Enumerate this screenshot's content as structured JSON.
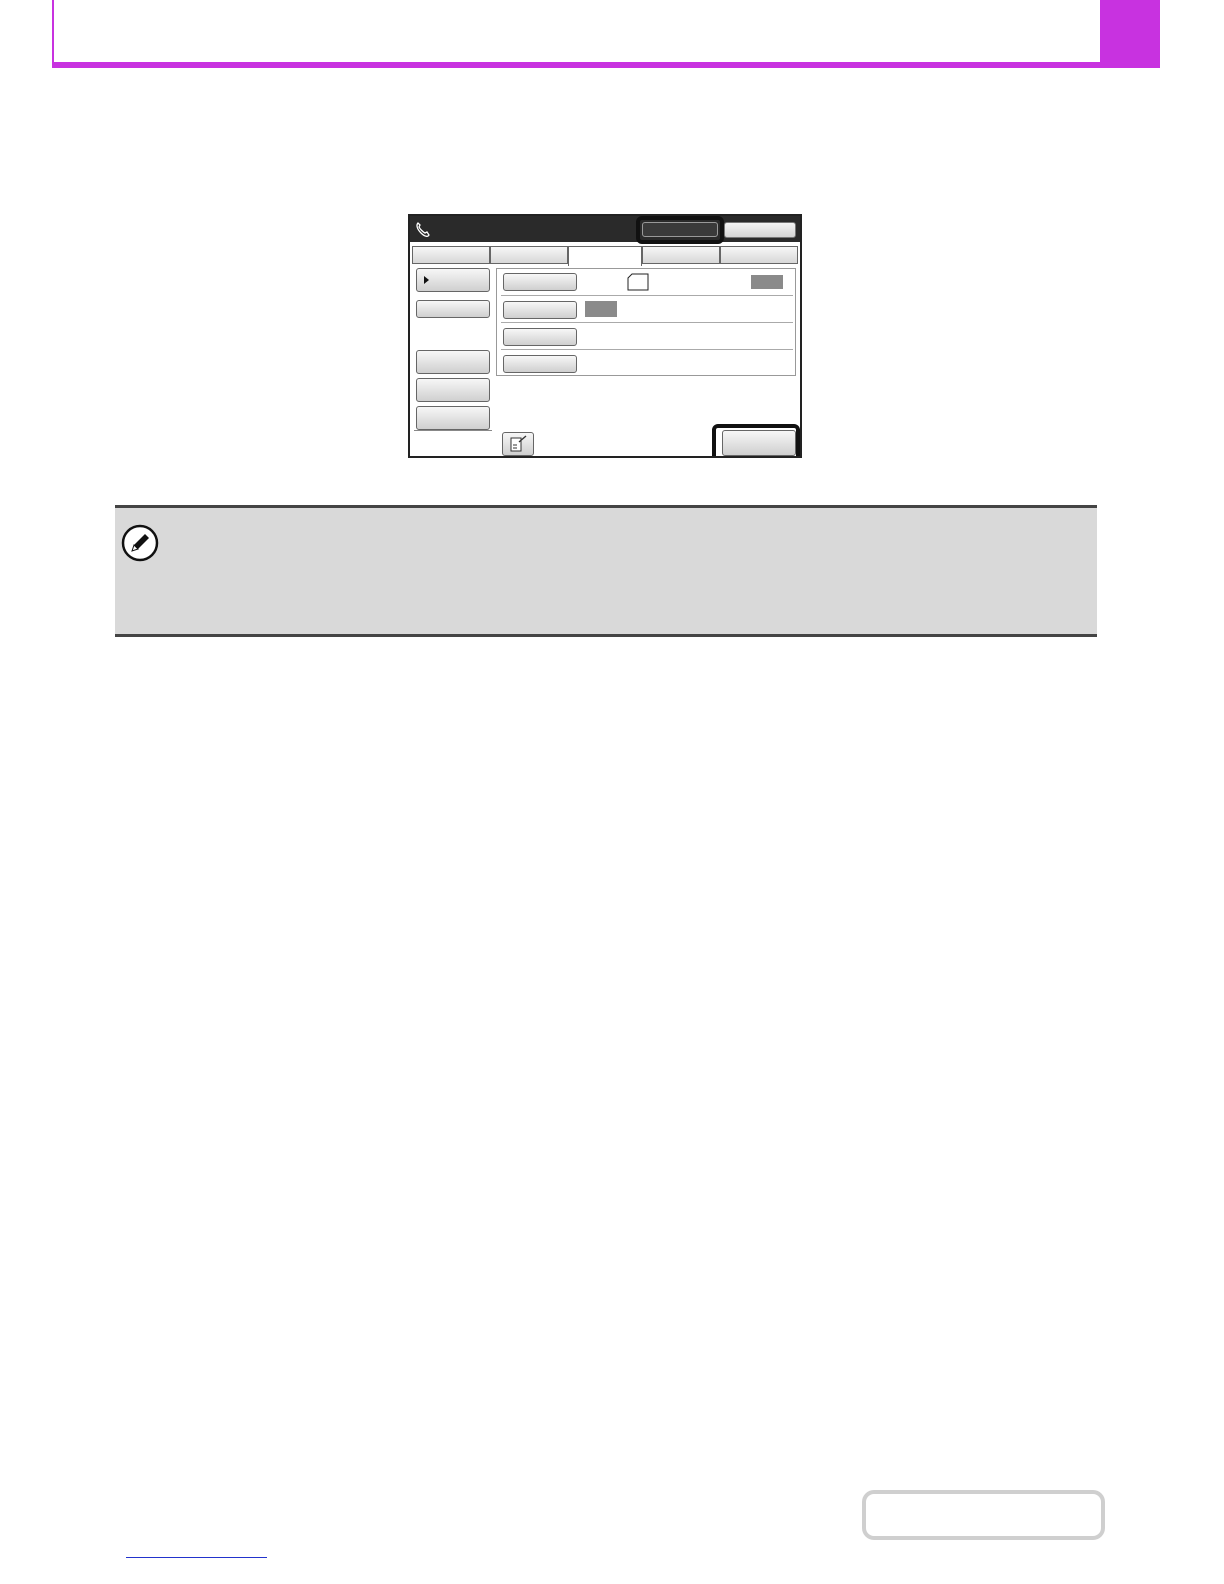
{
  "header": {
    "accent_color": "#c832e0"
  },
  "screen": {
    "topbar_icon": "phone-icon",
    "tabs_count_visible": 5,
    "active_tab_index": 2,
    "settings_rows": 4,
    "side_buttons": 5,
    "paper_icon": "paper-portrait-icon",
    "bottom_left_icon": "document-edit-icon"
  },
  "note": {
    "icon": "pencil-note-icon",
    "background_color": "#d9d9d9"
  },
  "footer": {
    "link_color": "#2233cc"
  }
}
